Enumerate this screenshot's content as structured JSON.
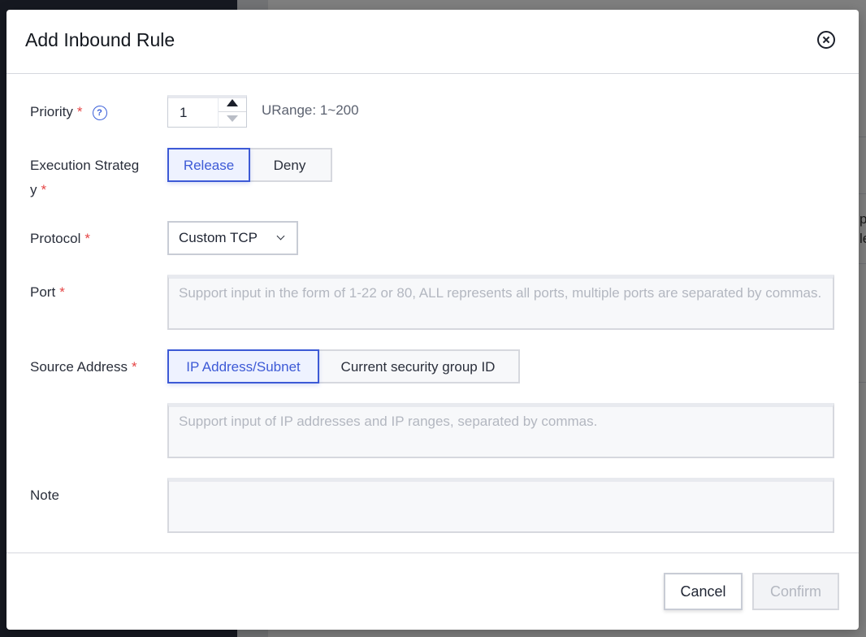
{
  "background": {
    "fragment_lines": [
      "p",
      "le"
    ]
  },
  "dialog": {
    "title": "Add Inbound Rule"
  },
  "form": {
    "priority": {
      "label": "Priority",
      "required_mark": "*",
      "help_glyph": "?",
      "value": "1",
      "range_hint": "URange: 1~200"
    },
    "execution_strategy": {
      "label_line1": "Execution Strateg",
      "label_line2": "y",
      "required_mark": "*",
      "options": [
        "Release",
        "Deny"
      ],
      "selected": "Release"
    },
    "protocol": {
      "label": "Protocol",
      "required_mark": "*",
      "value": "Custom TCP"
    },
    "port": {
      "label": "Port",
      "required_mark": "*",
      "placeholder": "Support input in the form of 1-22 or 80, ALL represents all ports, multiple ports are separated by commas."
    },
    "source_address": {
      "label": "Source Address",
      "required_mark": "*",
      "options": [
        "IP Address/Subnet",
        "Current security group ID"
      ],
      "selected": "IP Address/Subnet",
      "placeholder": "Support input of IP addresses and IP ranges, separated by commas."
    },
    "note": {
      "label": "Note",
      "value": ""
    }
  },
  "footer": {
    "cancel_label": "Cancel",
    "confirm_label": "Confirm"
  },
  "colors": {
    "accent": "#3d5ad6",
    "required": "#e54545",
    "overlay": "rgba(0,0,0,0.5)"
  },
  "icons": [
    "close-icon",
    "help-icon",
    "caret-up-icon",
    "caret-down-icon",
    "chevron-down-icon"
  ]
}
